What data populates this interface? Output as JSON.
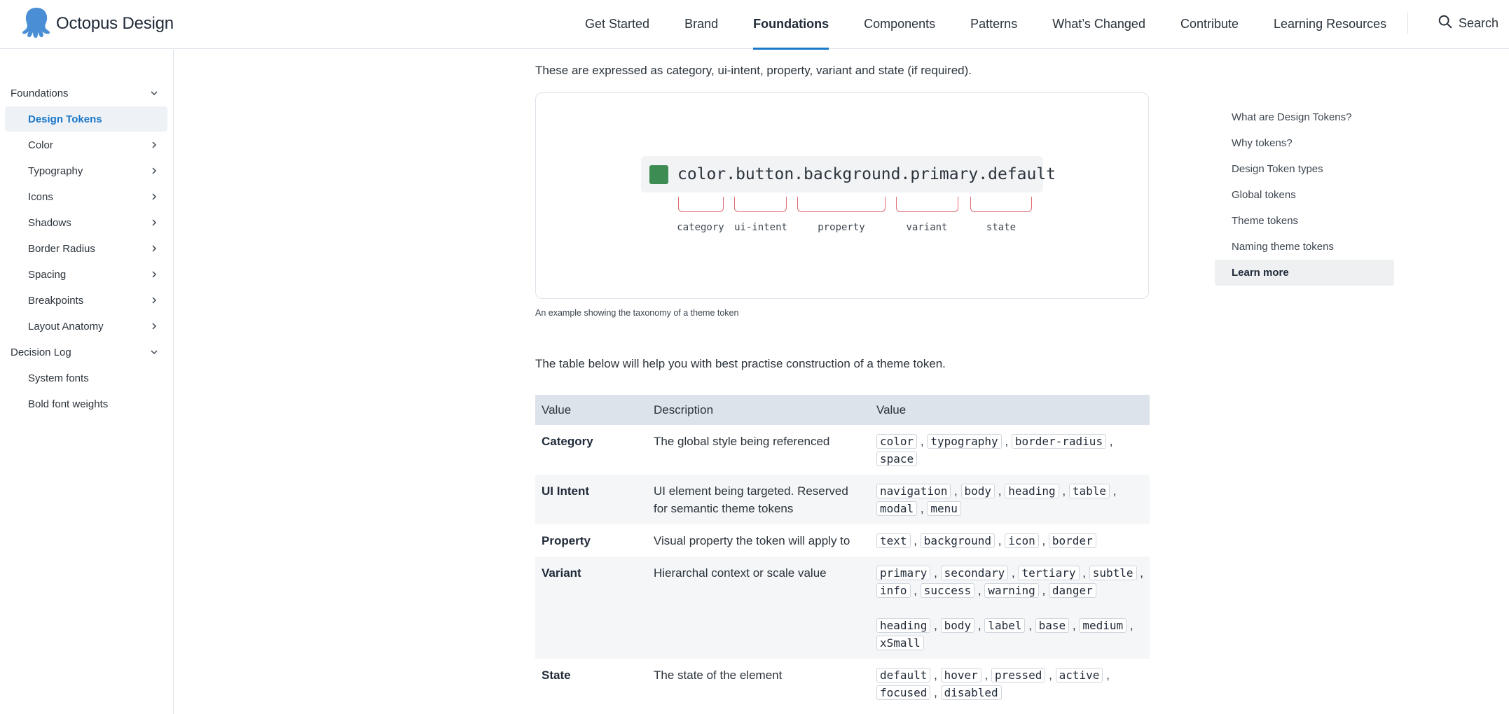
{
  "brand": {
    "name": "Octopus Design",
    "color": "#1a77ca"
  },
  "nav": [
    {
      "label": "Get Started",
      "active": false
    },
    {
      "label": "Brand",
      "active": false
    },
    {
      "label": "Foundations",
      "active": true
    },
    {
      "label": "Components",
      "active": false
    },
    {
      "label": "Patterns",
      "active": false
    },
    {
      "label": "What’s Changed",
      "active": false
    },
    {
      "label": "Contribute",
      "active": false
    },
    {
      "label": "Learning Resources",
      "active": false
    }
  ],
  "search": {
    "label": "Search",
    "icon": "search-icon"
  },
  "sidebar": {
    "items": [
      {
        "label": "Foundations",
        "level": 0,
        "chevron": "chevron-down-icon",
        "active": false
      },
      {
        "label": "Design Tokens",
        "level": 1,
        "chevron": "",
        "active": true
      },
      {
        "label": "Color",
        "level": 1,
        "chevron": "chevron-right-icon",
        "active": false
      },
      {
        "label": "Typography",
        "level": 1,
        "chevron": "chevron-right-icon",
        "active": false
      },
      {
        "label": "Icons",
        "level": 1,
        "chevron": "chevron-right-icon",
        "active": false
      },
      {
        "label": "Shadows",
        "level": 1,
        "chevron": "chevron-right-icon",
        "active": false
      },
      {
        "label": "Border Radius",
        "level": 1,
        "chevron": "chevron-right-icon",
        "active": false
      },
      {
        "label": "Spacing",
        "level": 1,
        "chevron": "chevron-right-icon",
        "active": false
      },
      {
        "label": "Breakpoints",
        "level": 1,
        "chevron": "chevron-right-icon",
        "active": false
      },
      {
        "label": "Layout Anatomy",
        "level": 1,
        "chevron": "chevron-right-icon",
        "active": false
      },
      {
        "label": "Decision Log",
        "level": 0,
        "chevron": "chevron-down-icon",
        "active": false
      },
      {
        "label": "System fonts",
        "level": 1,
        "chevron": "",
        "active": false
      },
      {
        "label": "Bold font weights",
        "level": 1,
        "chevron": "",
        "active": false
      }
    ]
  },
  "main": {
    "intro": "These are expressed as category, ui-intent, property, variant and state (if required).",
    "figure": {
      "token": "color.button.background.primary.default",
      "swatch_color": "#3c8c54",
      "labels": [
        "category",
        "ui-intent",
        "property",
        "variant",
        "state"
      ],
      "caption": "An example showing the taxonomy of a theme token"
    },
    "table_intro": "The table below will help you with best practise construction of a theme token.",
    "table": {
      "headers": [
        "Value",
        "Description",
        "Value"
      ],
      "rows": [
        {
          "key": "Category",
          "desc": "The global style being referenced",
          "groups": [
            [
              "color",
              "typography",
              "border-radius",
              "space"
            ]
          ]
        },
        {
          "key": "UI Intent",
          "desc": "UI element being targeted. Reserved for semantic theme tokens",
          "groups": [
            [
              "navigation",
              "body",
              "heading",
              "table",
              "modal",
              "menu"
            ]
          ]
        },
        {
          "key": "Property",
          "desc": "Visual property the token will apply to",
          "groups": [
            [
              "text",
              "background",
              "icon",
              "border"
            ]
          ]
        },
        {
          "key": "Variant",
          "desc": "Hierarchal context or scale value",
          "groups": [
            [
              "primary",
              "secondary",
              "tertiary",
              "subtle",
              "info",
              "success",
              "warning",
              "danger"
            ],
            [
              "heading",
              "body",
              "label",
              "base",
              "medium",
              "xSmall"
            ]
          ]
        },
        {
          "key": "State",
          "desc": "The state of the element",
          "groups": [
            [
              "default",
              "hover",
              "pressed",
              "active",
              "focused",
              "disabled"
            ]
          ]
        }
      ]
    }
  },
  "toc": {
    "items": [
      {
        "label": "What are Design Tokens?",
        "active": false
      },
      {
        "label": "Why tokens?",
        "active": false
      },
      {
        "label": "Design Token types",
        "active": false
      },
      {
        "label": "Global tokens",
        "active": false
      },
      {
        "label": "Theme tokens",
        "active": false
      },
      {
        "label": "Naming theme tokens",
        "active": false
      },
      {
        "label": "Learn more",
        "active": true
      }
    ]
  }
}
